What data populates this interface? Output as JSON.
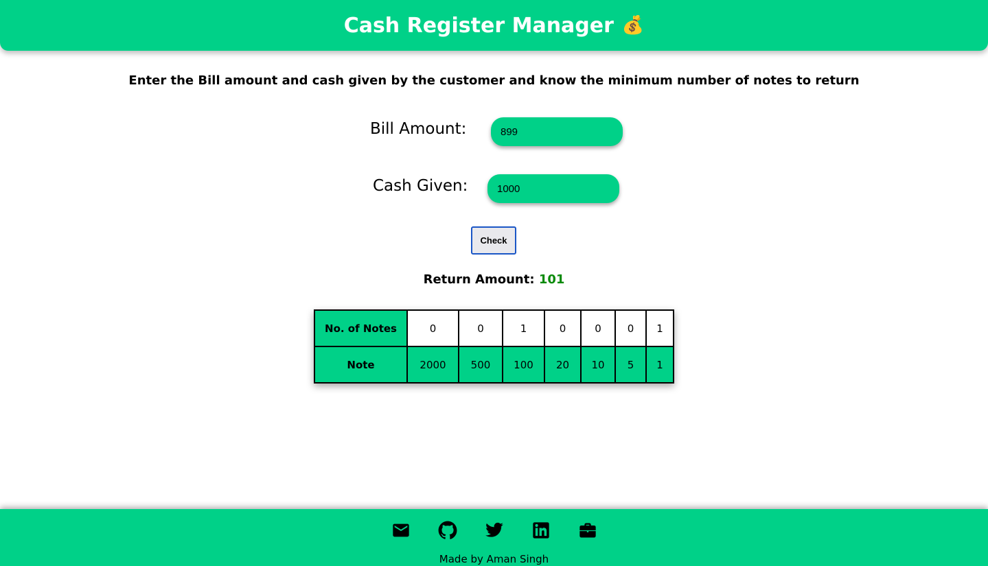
{
  "header": {
    "title": "Cash Register Manager",
    "emoji": "💰"
  },
  "instructions": "Enter the Bill amount and cash given by the customer and know the minimum number of notes to return",
  "bill": {
    "label": "Bill Amount:",
    "value": "899"
  },
  "cash": {
    "label": "Cash Given:",
    "value": "1000"
  },
  "check_label": "Check",
  "return": {
    "label": "Return Amount:",
    "value": "101"
  },
  "table": {
    "count_header": "No. of Notes",
    "note_header": "Note",
    "counts": [
      "0",
      "0",
      "1",
      "0",
      "0",
      "0",
      "1"
    ],
    "notes": [
      "2000",
      "500",
      "100",
      "20",
      "10",
      "5",
      "1"
    ]
  },
  "footer": {
    "icons": [
      "mail-icon",
      "github-icon",
      "twitter-icon",
      "linkedin-icon",
      "briefcase-icon"
    ],
    "credit": "Made by Aman Singh"
  },
  "colors": {
    "accent": "#00d188",
    "return_value": "#0a8a0a",
    "button_border": "#1a56c6"
  }
}
